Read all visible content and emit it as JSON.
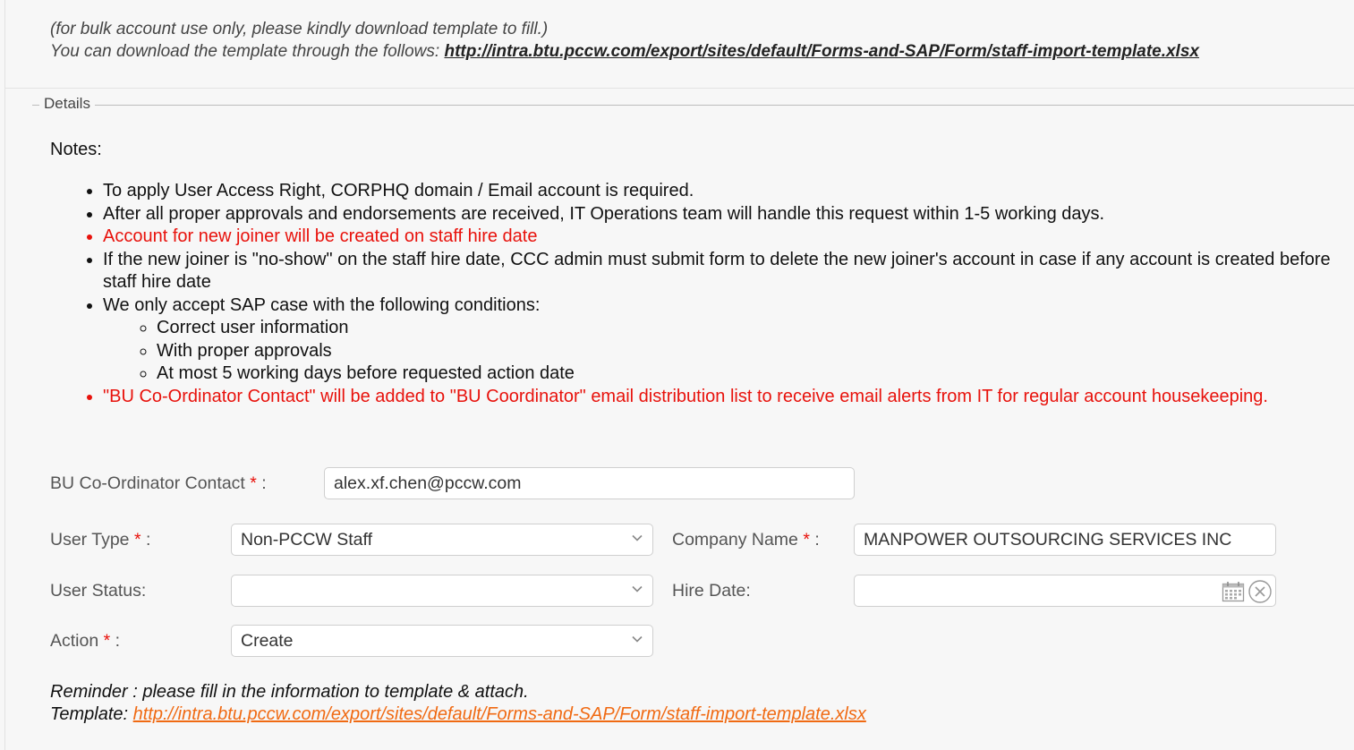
{
  "top_hint": {
    "line1": "(for bulk account use only, please kindly download template to fill.)",
    "line2_prefix": "You can download the template through the follows: ",
    "link": "http://intra.btu.pccw.com/export/sites/default/Forms-and-SAP/Form/staff-import-template.xlsx"
  },
  "details": {
    "legend": "Details",
    "notes_title": "Notes:",
    "notes": [
      "To apply User Access Right, CORPHQ domain / Email account is required.",
      "After all proper approvals and endorsements are received, IT Operations team will handle this request within 1-5 working days.",
      "Account for new joiner will be created on staff hire date",
      "If the new joiner is \"no-show\" on the staff hire date, CCC admin must submit form to delete the new joiner's account in case if any account is created before staff hire date",
      "We only accept SAP case with the following conditions:",
      "\"BU Co-Ordinator Contact\" will be added to \"BU Coordinator\" email distribution list to receive email alerts from IT for regular account housekeeping."
    ],
    "sub_notes": [
      "Correct user information",
      "With proper approvals",
      "At most 5 working days before requested action date"
    ]
  },
  "form": {
    "required_mark": "*",
    "bu_contact": {
      "label": "BU Co-Ordinator Contact",
      "suffix": " :",
      "value": "alex.xf.chen@pccw.com"
    },
    "user_type": {
      "label": "User Type",
      "suffix": " :",
      "value": "Non-PCCW Staff"
    },
    "company_name": {
      "label": "Company Name",
      "suffix": " :",
      "value": "MANPOWER OUTSOURCING SERVICES INC"
    },
    "user_status": {
      "label": "User Status:",
      "value": ""
    },
    "hire_date": {
      "label": "Hire Date:",
      "value": ""
    },
    "action": {
      "label": "Action",
      "suffix": " :",
      "value": "Create"
    }
  },
  "reminder": {
    "line1": "Reminder : please fill in the information to template & attach.",
    "template_label": "Template: ",
    "link": "http://intra.btu.pccw.com/export/sites/default/Forms-and-SAP/Form/staff-import-template.xlsx"
  },
  "colors": {
    "required": "#e8120c",
    "link_orange": "#f06a13",
    "background": "#f7f7f7"
  }
}
